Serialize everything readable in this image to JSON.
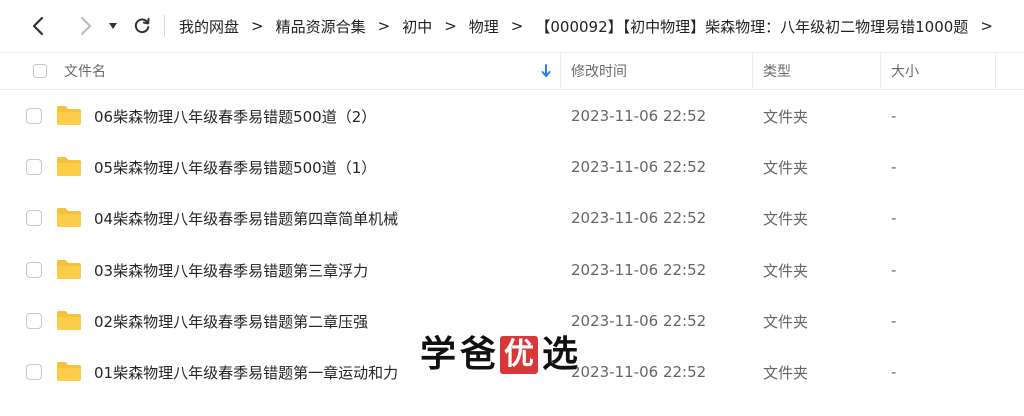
{
  "nav": {
    "breadcrumb": [
      "我的网盘",
      "精品资源合集",
      "初中",
      "物理",
      "【000092】【初中物理】柴森物理：八年级初二物理易错1000题"
    ],
    "separator": ">"
  },
  "columns": {
    "name": "文件名",
    "modified": "修改时间",
    "type": "类型",
    "size": "大小"
  },
  "rows": [
    {
      "name": "06柴森物理八年级春季易错题500道（2）",
      "modified": "2023-11-06 22:52",
      "type": "文件夹",
      "size": "-"
    },
    {
      "name": "05柴森物理八年级春季易错题500道（1）",
      "modified": "2023-11-06 22:52",
      "type": "文件夹",
      "size": "-"
    },
    {
      "name": "04柴森物理八年级春季易错题第四章简单机械",
      "modified": "2023-11-06 22:52",
      "type": "文件夹",
      "size": "-"
    },
    {
      "name": "03柴森物理八年级春季易错题第三章浮力",
      "modified": "2023-11-06 22:52",
      "type": "文件夹",
      "size": "-"
    },
    {
      "name": "02柴森物理八年级春季易错题第二章压强",
      "modified": "2023-11-06 22:52",
      "type": "文件夹",
      "size": "-"
    },
    {
      "name": "01柴森物理八年级春季易错题第一章运动和力",
      "modified": "2023-11-06 22:52",
      "type": "文件夹",
      "size": "-"
    }
  ],
  "watermark": {
    "chars": [
      "学",
      "爸",
      "优",
      "选"
    ]
  },
  "colors": {
    "folder": "#f7c23a",
    "sort_arrow": "#2e7cf6",
    "watermark_box": "#d9383a"
  }
}
